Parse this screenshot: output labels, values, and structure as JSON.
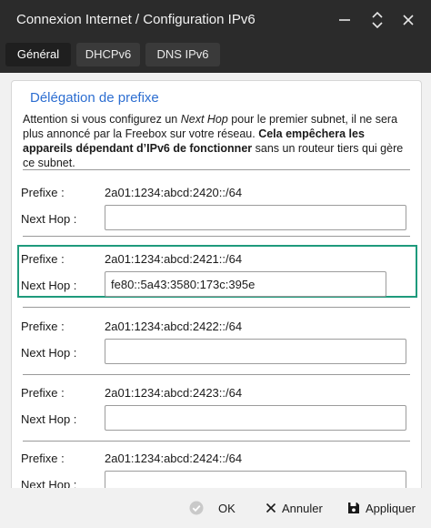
{
  "window": {
    "title": "Connexion Internet / Configuration IPv6"
  },
  "tabs": [
    {
      "label": "Général",
      "active": true
    },
    {
      "label": "DHCPv6",
      "active": false
    },
    {
      "label": "DNS IPv6",
      "active": false
    }
  ],
  "section": {
    "title": "Délégation de prefixe",
    "description": {
      "part1": "Attention si vous configurez un ",
      "italic": "Next Hop",
      "part2": " pour le premier subnet, il ne sera plus annoncé par la Freebox sur votre réseau. ",
      "bold": "Cela empêchera les appareils dépendant d’IPv6 de fonctionner",
      "part3": " sans un routeur tiers qui gère ce subnet."
    }
  },
  "labels": {
    "prefix": "Prefixe :",
    "next_hop": "Next Hop :"
  },
  "prefixes": [
    {
      "prefix": "2a01:1234:abcd:2420::/64",
      "next_hop": ""
    },
    {
      "prefix": "2a01:1234:abcd:2421::/64",
      "next_hop": "fe80::5a43:3580:173c:395e"
    },
    {
      "prefix": "2a01:1234:abcd:2422::/64",
      "next_hop": ""
    },
    {
      "prefix": "2a01:1234:abcd:2423::/64",
      "next_hop": ""
    },
    {
      "prefix": "2a01:1234:abcd:2424::/64",
      "next_hop": ""
    }
  ],
  "footer": {
    "ok_label": "OK",
    "cancel_label": "Annuler",
    "apply_label": "Appliquer"
  },
  "colors": {
    "titlebar": "#2b2b2b",
    "accent_title": "#2d6ed1",
    "highlight": "#1e9a7c"
  }
}
